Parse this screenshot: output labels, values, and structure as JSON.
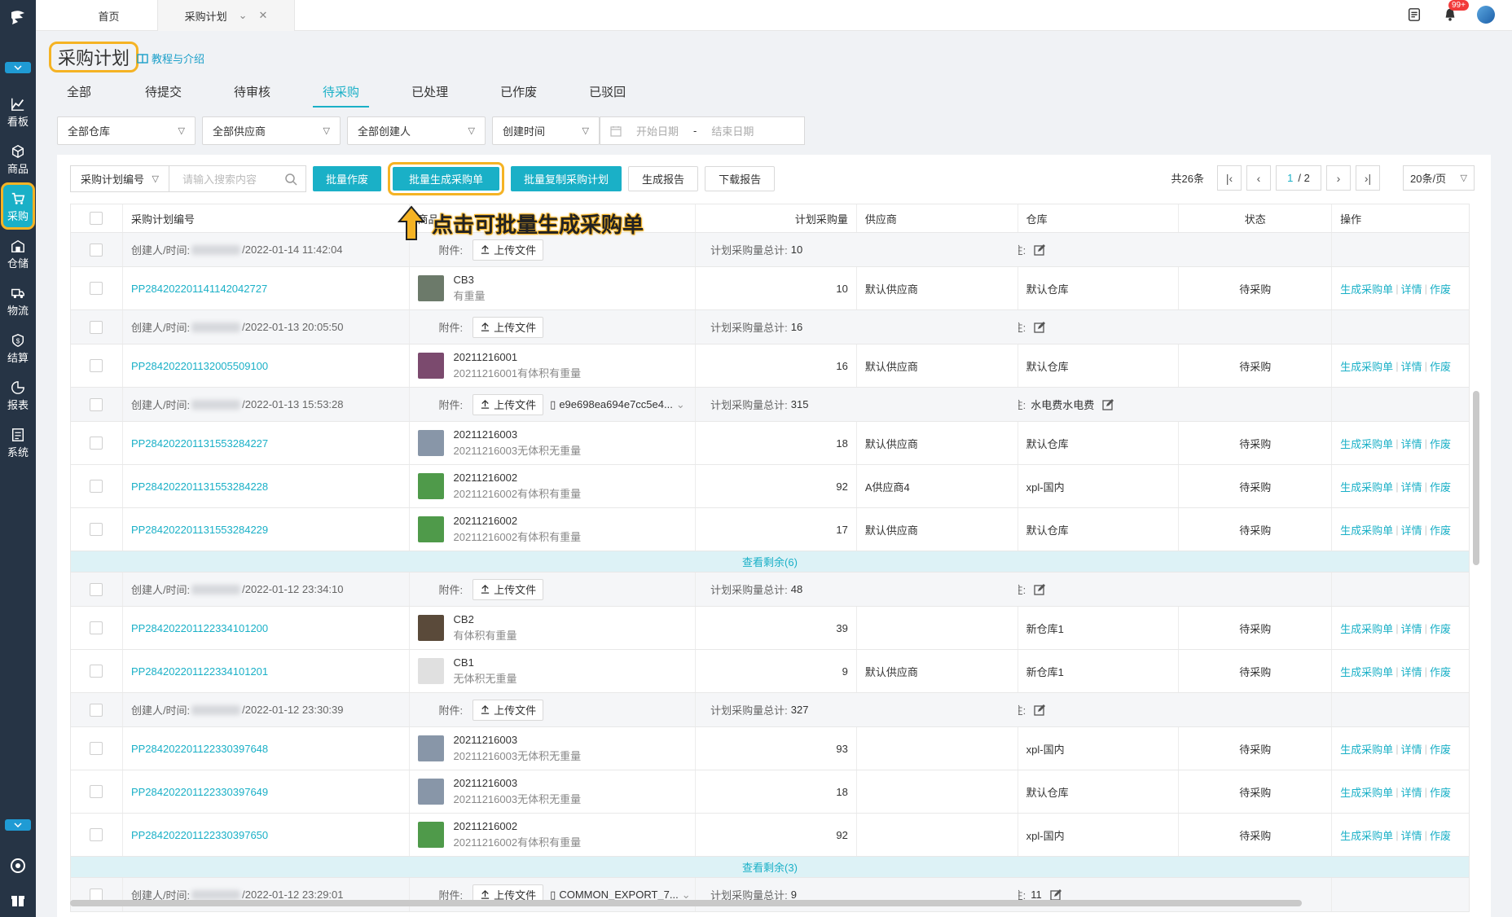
{
  "topbar": {
    "tabs": [
      {
        "label": "首页"
      },
      {
        "label": "采购计划"
      }
    ],
    "close_glyph": "✕",
    "chevron_glyph": "⌄",
    "notify_badge": "99+"
  },
  "sidebar": {
    "items": [
      {
        "label": "看板",
        "icon": "dashboard-icon"
      },
      {
        "label": "商品",
        "icon": "box-icon"
      },
      {
        "label": "采购",
        "icon": "cart-icon",
        "active": true
      },
      {
        "label": "仓储",
        "icon": "warehouse-icon"
      },
      {
        "label": "物流",
        "icon": "truck-icon"
      },
      {
        "label": "结算",
        "icon": "money-icon"
      },
      {
        "label": "报表",
        "icon": "report-icon"
      },
      {
        "label": "系统",
        "icon": "system-icon"
      }
    ]
  },
  "page": {
    "title": "采购计划",
    "tutorial": "教程与介绍"
  },
  "status_tabs": [
    "全部",
    "待提交",
    "待审核",
    "待采购",
    "已处理",
    "已作废",
    "已驳回"
  ],
  "active_status_tab": "待采购",
  "filters": {
    "warehouse": "全部仓库",
    "supplier": "全部供应商",
    "creator": "全部创建人",
    "time_type": "创建时间",
    "start_placeholder": "开始日期",
    "range_sep": "-",
    "end_placeholder": "结束日期"
  },
  "toolbar": {
    "search_type": "采购计划编号",
    "search_placeholder": "请输入搜索内容",
    "btn_void": "批量作废",
    "btn_generate": "批量生成采购单",
    "btn_copy": "批量复制采购计划",
    "btn_report": "生成报告",
    "btn_download": "下载报告"
  },
  "pager": {
    "total": "共26条",
    "current": "1",
    "pages": "/ 2",
    "size": "20条/页"
  },
  "callout": "点击可批量生成采购单",
  "table": {
    "headers": {
      "no": "采购计划编号",
      "product": "商品",
      "qty": "计划采购量",
      "supplier": "供应商",
      "warehouse": "仓库",
      "status": "状态",
      "ops": "操作"
    },
    "labels": {
      "creator": "创建人/时间:",
      "attach": "附件:",
      "upload": "上传文件",
      "qty_total": "计划采购量总计:",
      "remark": "备注:",
      "op_generate": "生成采购单",
      "op_detail": "详情",
      "op_void": "作废",
      "op_sep": "|"
    },
    "groups": [
      {
        "time": "/2022-01-14 11:42:04",
        "qty_total": "10",
        "remark": "",
        "file": "",
        "items": [
          {
            "no": "PP284202201141142042727",
            "name": "CB3",
            "sub": "有重量",
            "img": "#6c7a6a",
            "qty": "10",
            "supplier": "默认供应商",
            "warehouse": "默认仓库",
            "status": "待采购"
          }
        ],
        "more": ""
      },
      {
        "time": "/2022-01-13 20:05:50",
        "qty_total": "16",
        "remark": "",
        "file": "",
        "items": [
          {
            "no": "PP284202201132005509100",
            "name": "20211216001",
            "sub": "20211216001有体积有重量",
            "img": "#7b4a6e",
            "qty": "16",
            "supplier": "默认供应商",
            "warehouse": "默认仓库",
            "status": "待采购"
          }
        ],
        "more": ""
      },
      {
        "time": "/2022-01-13 15:53:28",
        "qty_total": "315",
        "remark": "水电费水电费",
        "file": "e9e698ea694e7cc5e4...",
        "items": [
          {
            "no": "PP284202201131553284227",
            "name": "20211216003",
            "sub": "20211216003无体积无重量",
            "img": "#8896a8",
            "qty": "18",
            "supplier": "默认供应商",
            "warehouse": "默认仓库",
            "status": "待采购"
          },
          {
            "no": "PP284202201131553284228",
            "name": "20211216002",
            "sub": "20211216002有体积有重量",
            "img": "#4f9a4a",
            "qty": "92",
            "supplier": "A供应商4",
            "warehouse": "xpl-国内",
            "status": "待采购"
          },
          {
            "no": "PP284202201131553284229",
            "name": "20211216002",
            "sub": "20211216002有体积有重量",
            "img": "#4f9a4a",
            "qty": "17",
            "supplier": "默认供应商",
            "warehouse": "默认仓库",
            "status": "待采购"
          }
        ],
        "more": "查看剩余(6)"
      },
      {
        "time": "/2022-01-12 23:34:10",
        "qty_total": "48",
        "remark": "",
        "file": "",
        "items": [
          {
            "no": "PP284202201122334101200",
            "name": "CB2",
            "sub": "有体积有重量",
            "img": "#5a4a3a",
            "qty": "39",
            "supplier": "",
            "warehouse": "新仓库1",
            "status": "待采购"
          },
          {
            "no": "PP284202201122334101201",
            "name": "CB1",
            "sub": "无体积无重量",
            "img": "#e0e0e0",
            "qty": "9",
            "supplier": "默认供应商",
            "warehouse": "新仓库1",
            "status": "待采购"
          }
        ],
        "more": ""
      },
      {
        "time": "/2022-01-12 23:30:39",
        "qty_total": "327",
        "remark": "",
        "file": "",
        "items": [
          {
            "no": "PP284202201122330397648",
            "name": "20211216003",
            "sub": "20211216003无体积无重量",
            "img": "#8896a8",
            "qty": "93",
            "supplier": "",
            "warehouse": "xpl-国内",
            "status": "待采购"
          },
          {
            "no": "PP284202201122330397649",
            "name": "20211216003",
            "sub": "20211216003无体积无重量",
            "img": "#8896a8",
            "qty": "18",
            "supplier": "",
            "warehouse": "默认仓库",
            "status": "待采购"
          },
          {
            "no": "PP284202201122330397650",
            "name": "20211216002",
            "sub": "20211216002有体积有重量",
            "img": "#4f9a4a",
            "qty": "92",
            "supplier": "",
            "warehouse": "xpl-国内",
            "status": "待采购"
          }
        ],
        "more": "查看剩余(3)"
      },
      {
        "time": "/2022-01-12 23:29:01",
        "qty_total": "9",
        "remark": "11",
        "file": "COMMON_EXPORT_7...",
        "items": [],
        "more": ""
      }
    ]
  },
  "colors": {
    "accent": "#1ab0c7",
    "sidebar": "#263445",
    "highlight": "#f5b324"
  }
}
